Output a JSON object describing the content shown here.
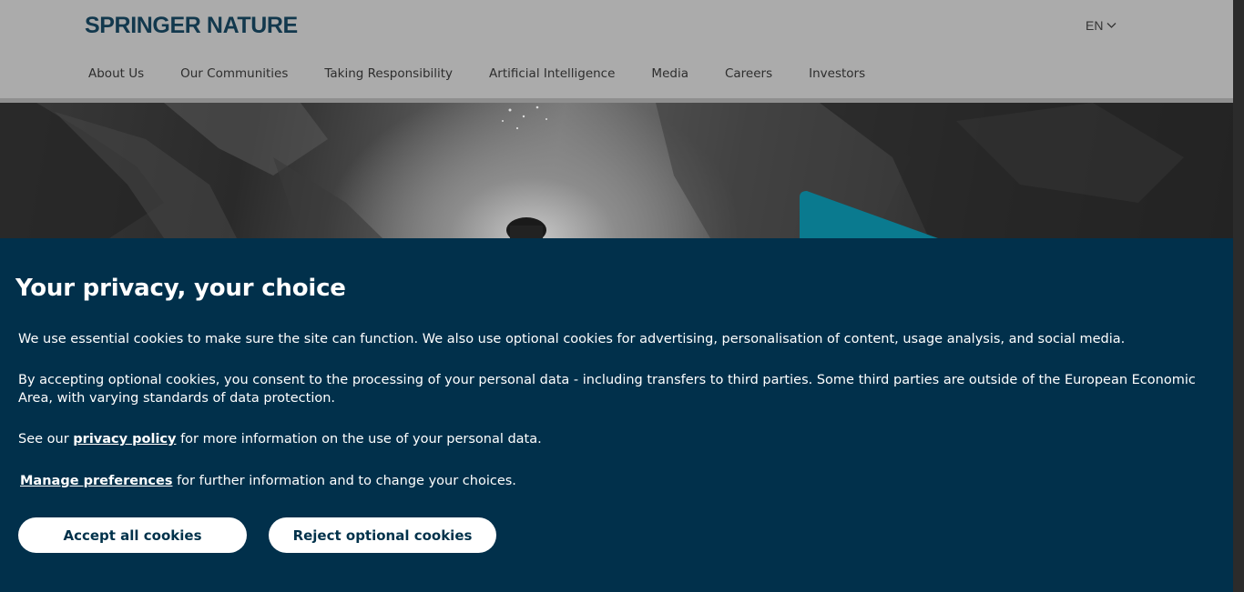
{
  "header": {
    "logo": "SPRINGER NATURE",
    "language": "EN",
    "nav": [
      {
        "label": "About Us"
      },
      {
        "label": "Our Communities"
      },
      {
        "label": "Taking Responsibility"
      },
      {
        "label": "Artificial Intelligence"
      },
      {
        "label": "Media"
      },
      {
        "label": "Careers"
      },
      {
        "label": "Investors"
      }
    ]
  },
  "colors": {
    "banner_bg": "#01304b",
    "brand_teal": "#0a7a8f",
    "button_text": "#01324b"
  },
  "cookie_banner": {
    "title": "Your privacy, your choice",
    "paragraph1": "We use essential cookies to make sure the site can function. We also use optional cookies for advertising, personalisation of content, usage analysis, and social media.",
    "paragraph2": "By accepting optional cookies, you consent to the processing of your personal data - including transfers to third parties. Some third parties are outside of the European Economic Area, with varying standards of data protection.",
    "paragraph3_prefix": "See our ",
    "privacy_link": "privacy policy",
    "paragraph3_suffix": " for more information on the use of your personal data.",
    "manage_link": "Manage preferences",
    "manage_suffix": " for further information and to change your choices.",
    "accept_button": "Accept all cookies",
    "reject_button": "Reject optional cookies"
  }
}
